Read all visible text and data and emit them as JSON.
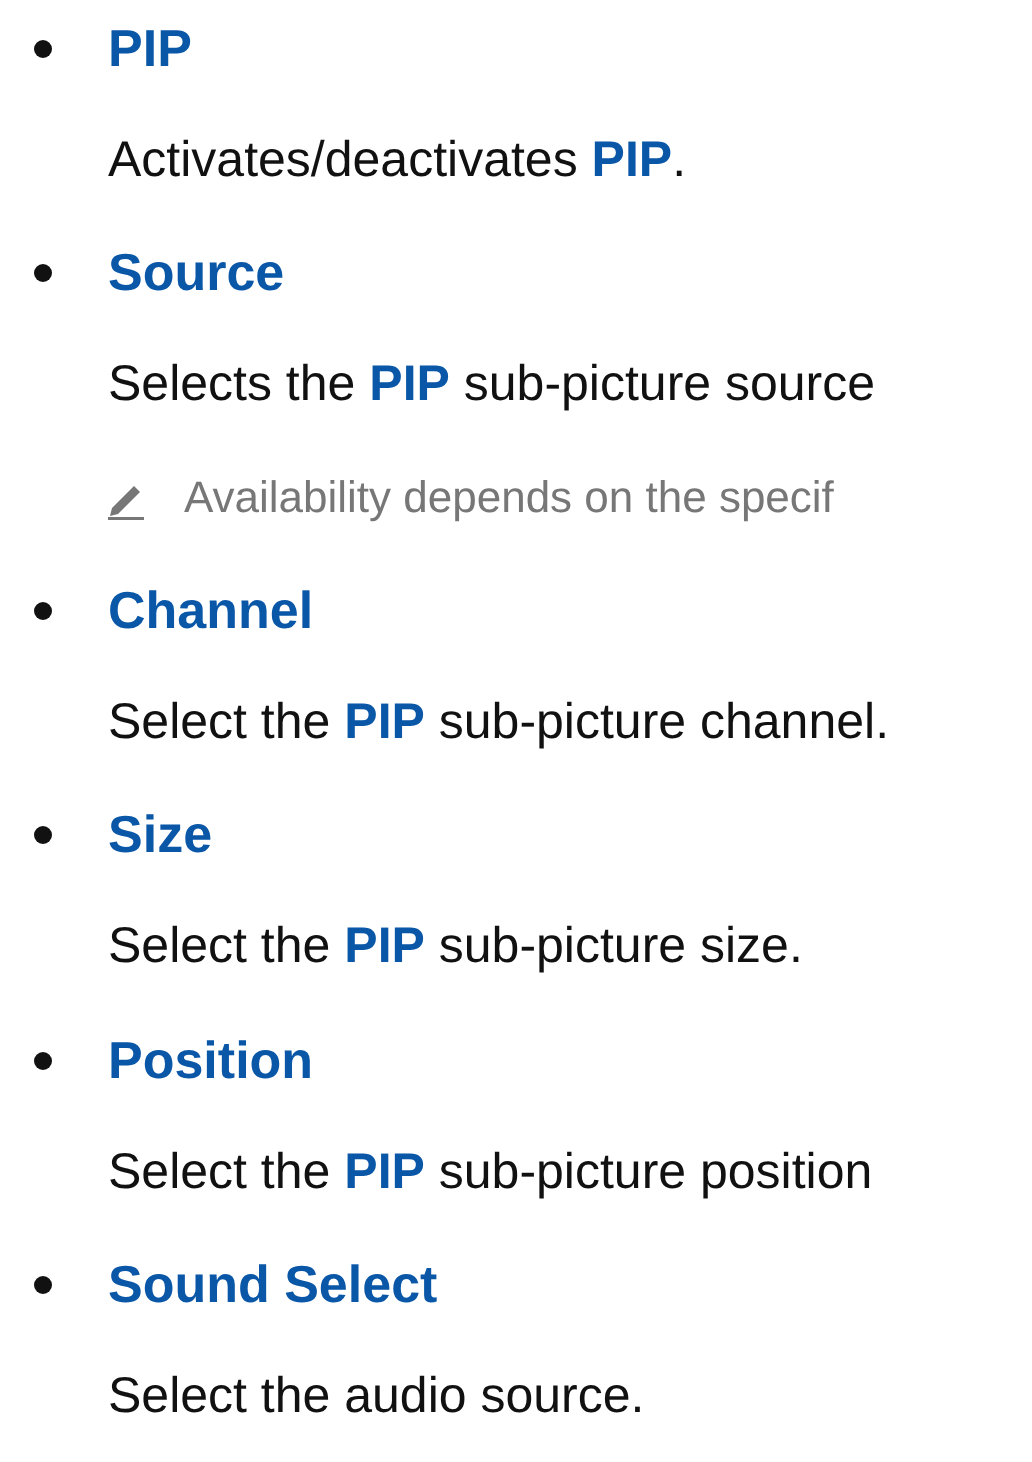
{
  "items": [
    {
      "title": "PIP",
      "description": "Activates/deactivates **PIP**."
    },
    {
      "title": "Source",
      "description": "Selects the **PIP** sub-picture source",
      "note": "Availability depends on the specif"
    },
    {
      "title": "Channel",
      "description": "Select the **PIP** sub-picture channel."
    },
    {
      "title": "Size",
      "description": "Select the **PIP** sub-picture size."
    },
    {
      "title": "Position",
      "description": "Select the **PIP** sub-picture position"
    },
    {
      "title": "Sound Select",
      "description": "Select the audio source."
    }
  ]
}
